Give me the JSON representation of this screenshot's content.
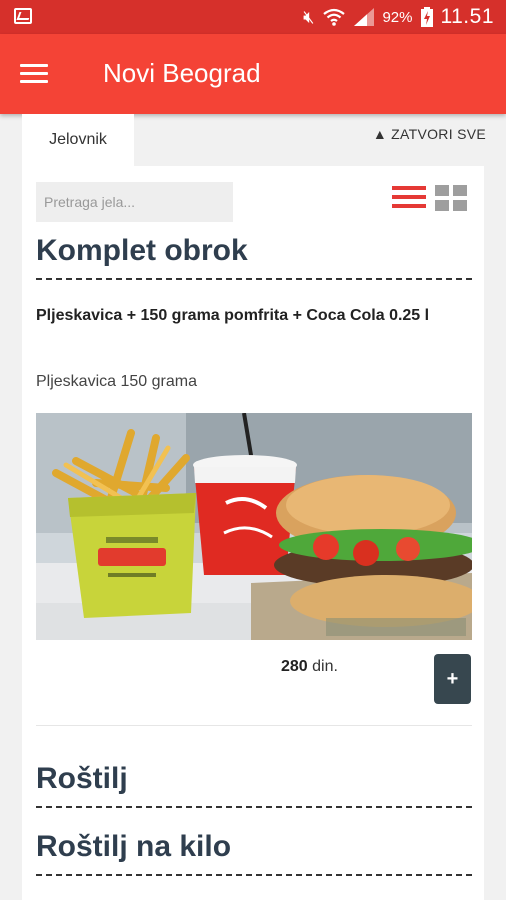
{
  "status_bar": {
    "battery": "92%",
    "time": "11.51",
    "icons": [
      "picture-icon",
      "mute-vibrate-icon",
      "wifi-icon",
      "signal-icon",
      "battery-charging-icon"
    ]
  },
  "app_bar": {
    "title": "Novi Beograd",
    "menu_icon": "hamburger-icon"
  },
  "tabs": [
    {
      "label": "Jelovnik"
    }
  ],
  "collapse_all": "▲ ZATVORI SVE",
  "search": {
    "placeholder": "Pretraga jela...",
    "value": ""
  },
  "view_toggle": {
    "list_icon": "list-view-icon",
    "grid_icon": "grid-view-icon",
    "active": "list"
  },
  "sections": [
    {
      "title": "Komplet obrok",
      "items": [
        {
          "name": "Pljeskavica + 150 grama pomfrita + Coca Cola 0.25 l",
          "description": "Pljeskavica 150 grama",
          "price_value": "280",
          "price_unit": " din.",
          "add_label": "+"
        }
      ]
    },
    {
      "title": "Roštilj"
    },
    {
      "title": "Roštilj na kilo"
    }
  ],
  "colors": {
    "status_bar": "#d6302b",
    "app_bar": "#f44336",
    "heading": "#2f3e4e",
    "button": "#37474f",
    "accent": "#e53935"
  }
}
